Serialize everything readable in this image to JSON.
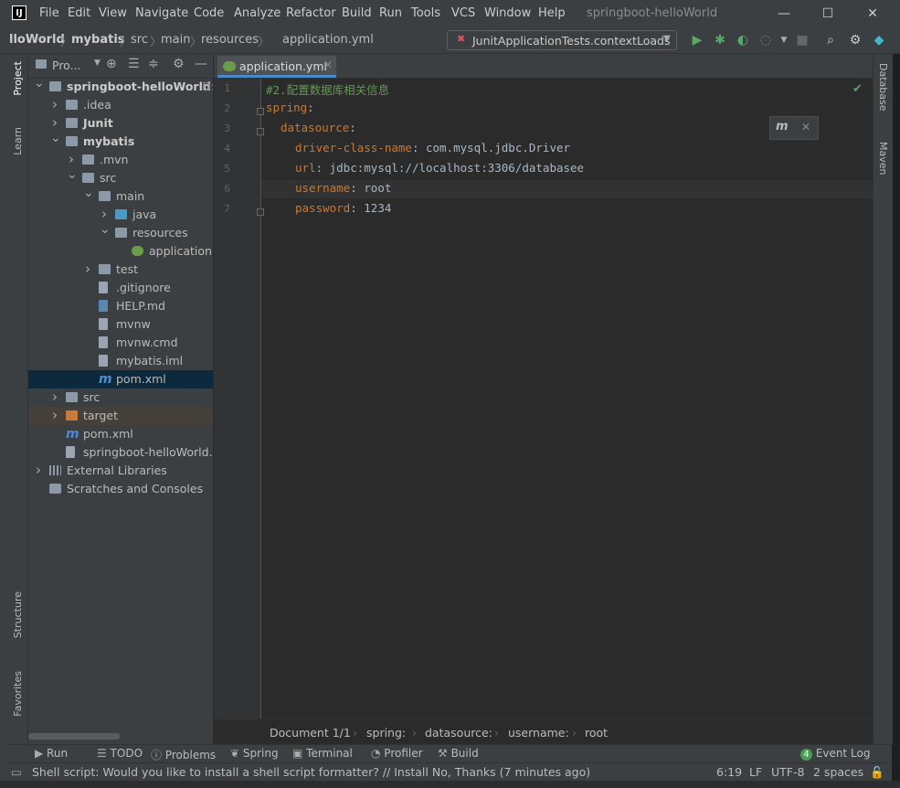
{
  "menu": [
    "File",
    "Edit",
    "View",
    "Navigate",
    "Code",
    "Analyze",
    "Refactor",
    "Build",
    "Run",
    "Tools",
    "VCS",
    "Window",
    "Help"
  ],
  "window_title": "springboot-helloWorld",
  "breadcrumbs": [
    "lloWorld",
    "mybatis",
    "src",
    "main",
    "resources",
    "application.yml"
  ],
  "run_config": "JunitApplicationTests.contextLoads",
  "project_panel": {
    "title": "Pro...",
    "tree": [
      {
        "label": "springboot-helloWorld",
        "suffix": "D:",
        "depth": 0,
        "arrow": "down",
        "icon": "folder",
        "bold": true
      },
      {
        "label": ".idea",
        "depth": 1,
        "arrow": "right",
        "icon": "folder"
      },
      {
        "label": "Junit",
        "depth": 1,
        "arrow": "right",
        "icon": "folder",
        "bold": true
      },
      {
        "label": "mybatis",
        "depth": 1,
        "arrow": "down",
        "icon": "folder",
        "bold": true
      },
      {
        "label": ".mvn",
        "depth": 2,
        "arrow": "right",
        "icon": "folder"
      },
      {
        "label": "src",
        "depth": 2,
        "arrow": "down",
        "icon": "folder"
      },
      {
        "label": "main",
        "depth": 3,
        "arrow": "down",
        "icon": "folder"
      },
      {
        "label": "java",
        "depth": 4,
        "arrow": "right",
        "icon": "folder-blue"
      },
      {
        "label": "resources",
        "depth": 4,
        "arrow": "down",
        "icon": "folder"
      },
      {
        "label": "application.y",
        "depth": 5,
        "arrow": "",
        "icon": "spring"
      },
      {
        "label": "test",
        "depth": 3,
        "arrow": "right",
        "icon": "folder"
      },
      {
        "label": ".gitignore",
        "depth": 3,
        "arrow": "",
        "icon": "file"
      },
      {
        "label": "HELP.md",
        "depth": 3,
        "arrow": "",
        "icon": "md"
      },
      {
        "label": "mvnw",
        "depth": 3,
        "arrow": "",
        "icon": "file"
      },
      {
        "label": "mvnw.cmd",
        "depth": 3,
        "arrow": "",
        "icon": "file"
      },
      {
        "label": "mybatis.iml",
        "depth": 3,
        "arrow": "",
        "icon": "file"
      },
      {
        "label": "pom.xml",
        "depth": 3,
        "arrow": "",
        "icon": "maven",
        "selected": true
      },
      {
        "label": "src",
        "depth": 1,
        "arrow": "right",
        "icon": "folder"
      },
      {
        "label": "target",
        "depth": 1,
        "arrow": "right",
        "icon": "folder-orange",
        "target": true
      },
      {
        "label": "pom.xml",
        "depth": 1,
        "arrow": "",
        "icon": "maven"
      },
      {
        "label": "springboot-helloWorld.i",
        "depth": 1,
        "arrow": "",
        "icon": "file"
      },
      {
        "label": "External Libraries",
        "depth": 0,
        "arrow": "right",
        "icon": "lib"
      },
      {
        "label": "Scratches and Consoles",
        "depth": 0,
        "arrow": "",
        "icon": "scratch"
      }
    ]
  },
  "left_stripe": [
    "Project",
    "Learn",
    "Structure",
    "Favorites"
  ],
  "right_stripe": [
    "Database",
    "Maven"
  ],
  "editor_tab": "application.yml",
  "code_lines": [
    {
      "n": "1",
      "indent": 0,
      "key": "",
      "val": "#2.配置数据库相关信息",
      "type": "comment"
    },
    {
      "n": "2",
      "indent": 0,
      "key": "spring",
      "val": "",
      "type": "kv"
    },
    {
      "n": "3",
      "indent": 2,
      "key": "datasource",
      "val": "",
      "type": "kv"
    },
    {
      "n": "4",
      "indent": 4,
      "key": "driver-class-name",
      "val": " com.mysql.jdbc.Driver",
      "type": "kv"
    },
    {
      "n": "5",
      "indent": 4,
      "key": "url",
      "val": " jdbc:mysql://localhost:3306/databasee",
      "type": "kv"
    },
    {
      "n": "6",
      "indent": 4,
      "key": "username",
      "val": " root",
      "type": "kv"
    },
    {
      "n": "7",
      "indent": 4,
      "key": "password",
      "val": " 1234",
      "type": "kv"
    }
  ],
  "editor_breadcrumbs": [
    "Document 1/1",
    "spring:",
    "datasource:",
    "username:",
    "root"
  ],
  "bottom_tools": [
    "Run",
    "TODO",
    "Problems",
    "Spring",
    "Terminal",
    "Profiler",
    "Build"
  ],
  "event_log": {
    "count": "4",
    "label": "Event Log"
  },
  "status": {
    "message": "Shell script: Would you like to install a shell script formatter? // Install   No, Thanks (7 minutes ago)",
    "position": "6:19",
    "line_sep": "LF",
    "encoding": "UTF-8",
    "indent": "2 spaces"
  },
  "colors": {
    "accent": "#4a88c7",
    "key": "#cc7832",
    "comment": "#629755",
    "value": "#a9b7c6"
  }
}
